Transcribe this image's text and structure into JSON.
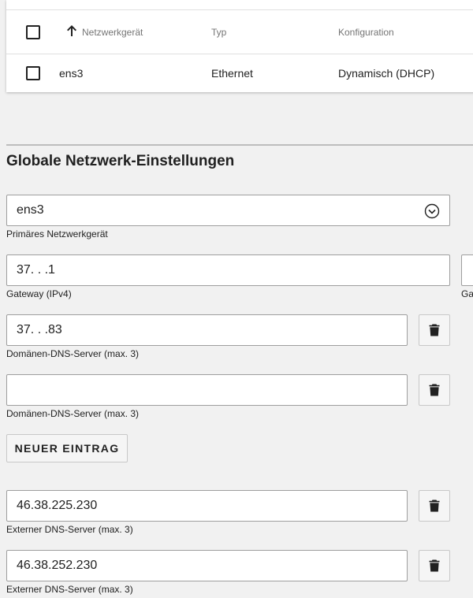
{
  "table": {
    "headers": {
      "device": "Netzwerkgerät",
      "type": "Typ",
      "config": "Konfiguration"
    },
    "rows": [
      {
        "device": "ens3",
        "type": "Ethernet",
        "config": "Dynamisch (DHCP)"
      }
    ]
  },
  "global": {
    "title": "Globale Netzwerk-Einstellungen",
    "primary_device": {
      "value": "ens3",
      "label": "Primäres Netzwerkgerät"
    },
    "gateway": {
      "value": "37.  .   .1",
      "label": "Gateway (IPv4)"
    },
    "gateway6": {
      "label": "Gat"
    },
    "domain_dns": [
      {
        "value": "37.   .   .83",
        "label": "Domänen-DNS-Server (max. 3)"
      },
      {
        "value": "",
        "label": "Domänen-DNS-Server (max. 3)"
      }
    ],
    "add_entry_label": "NEUER EINTRAG",
    "external_dns": [
      {
        "value": "46.38.225.230",
        "label": "Externer DNS-Server (max. 3)"
      },
      {
        "value": "46.38.252.230",
        "label": "Externer DNS-Server (max. 3)"
      }
    ]
  }
}
